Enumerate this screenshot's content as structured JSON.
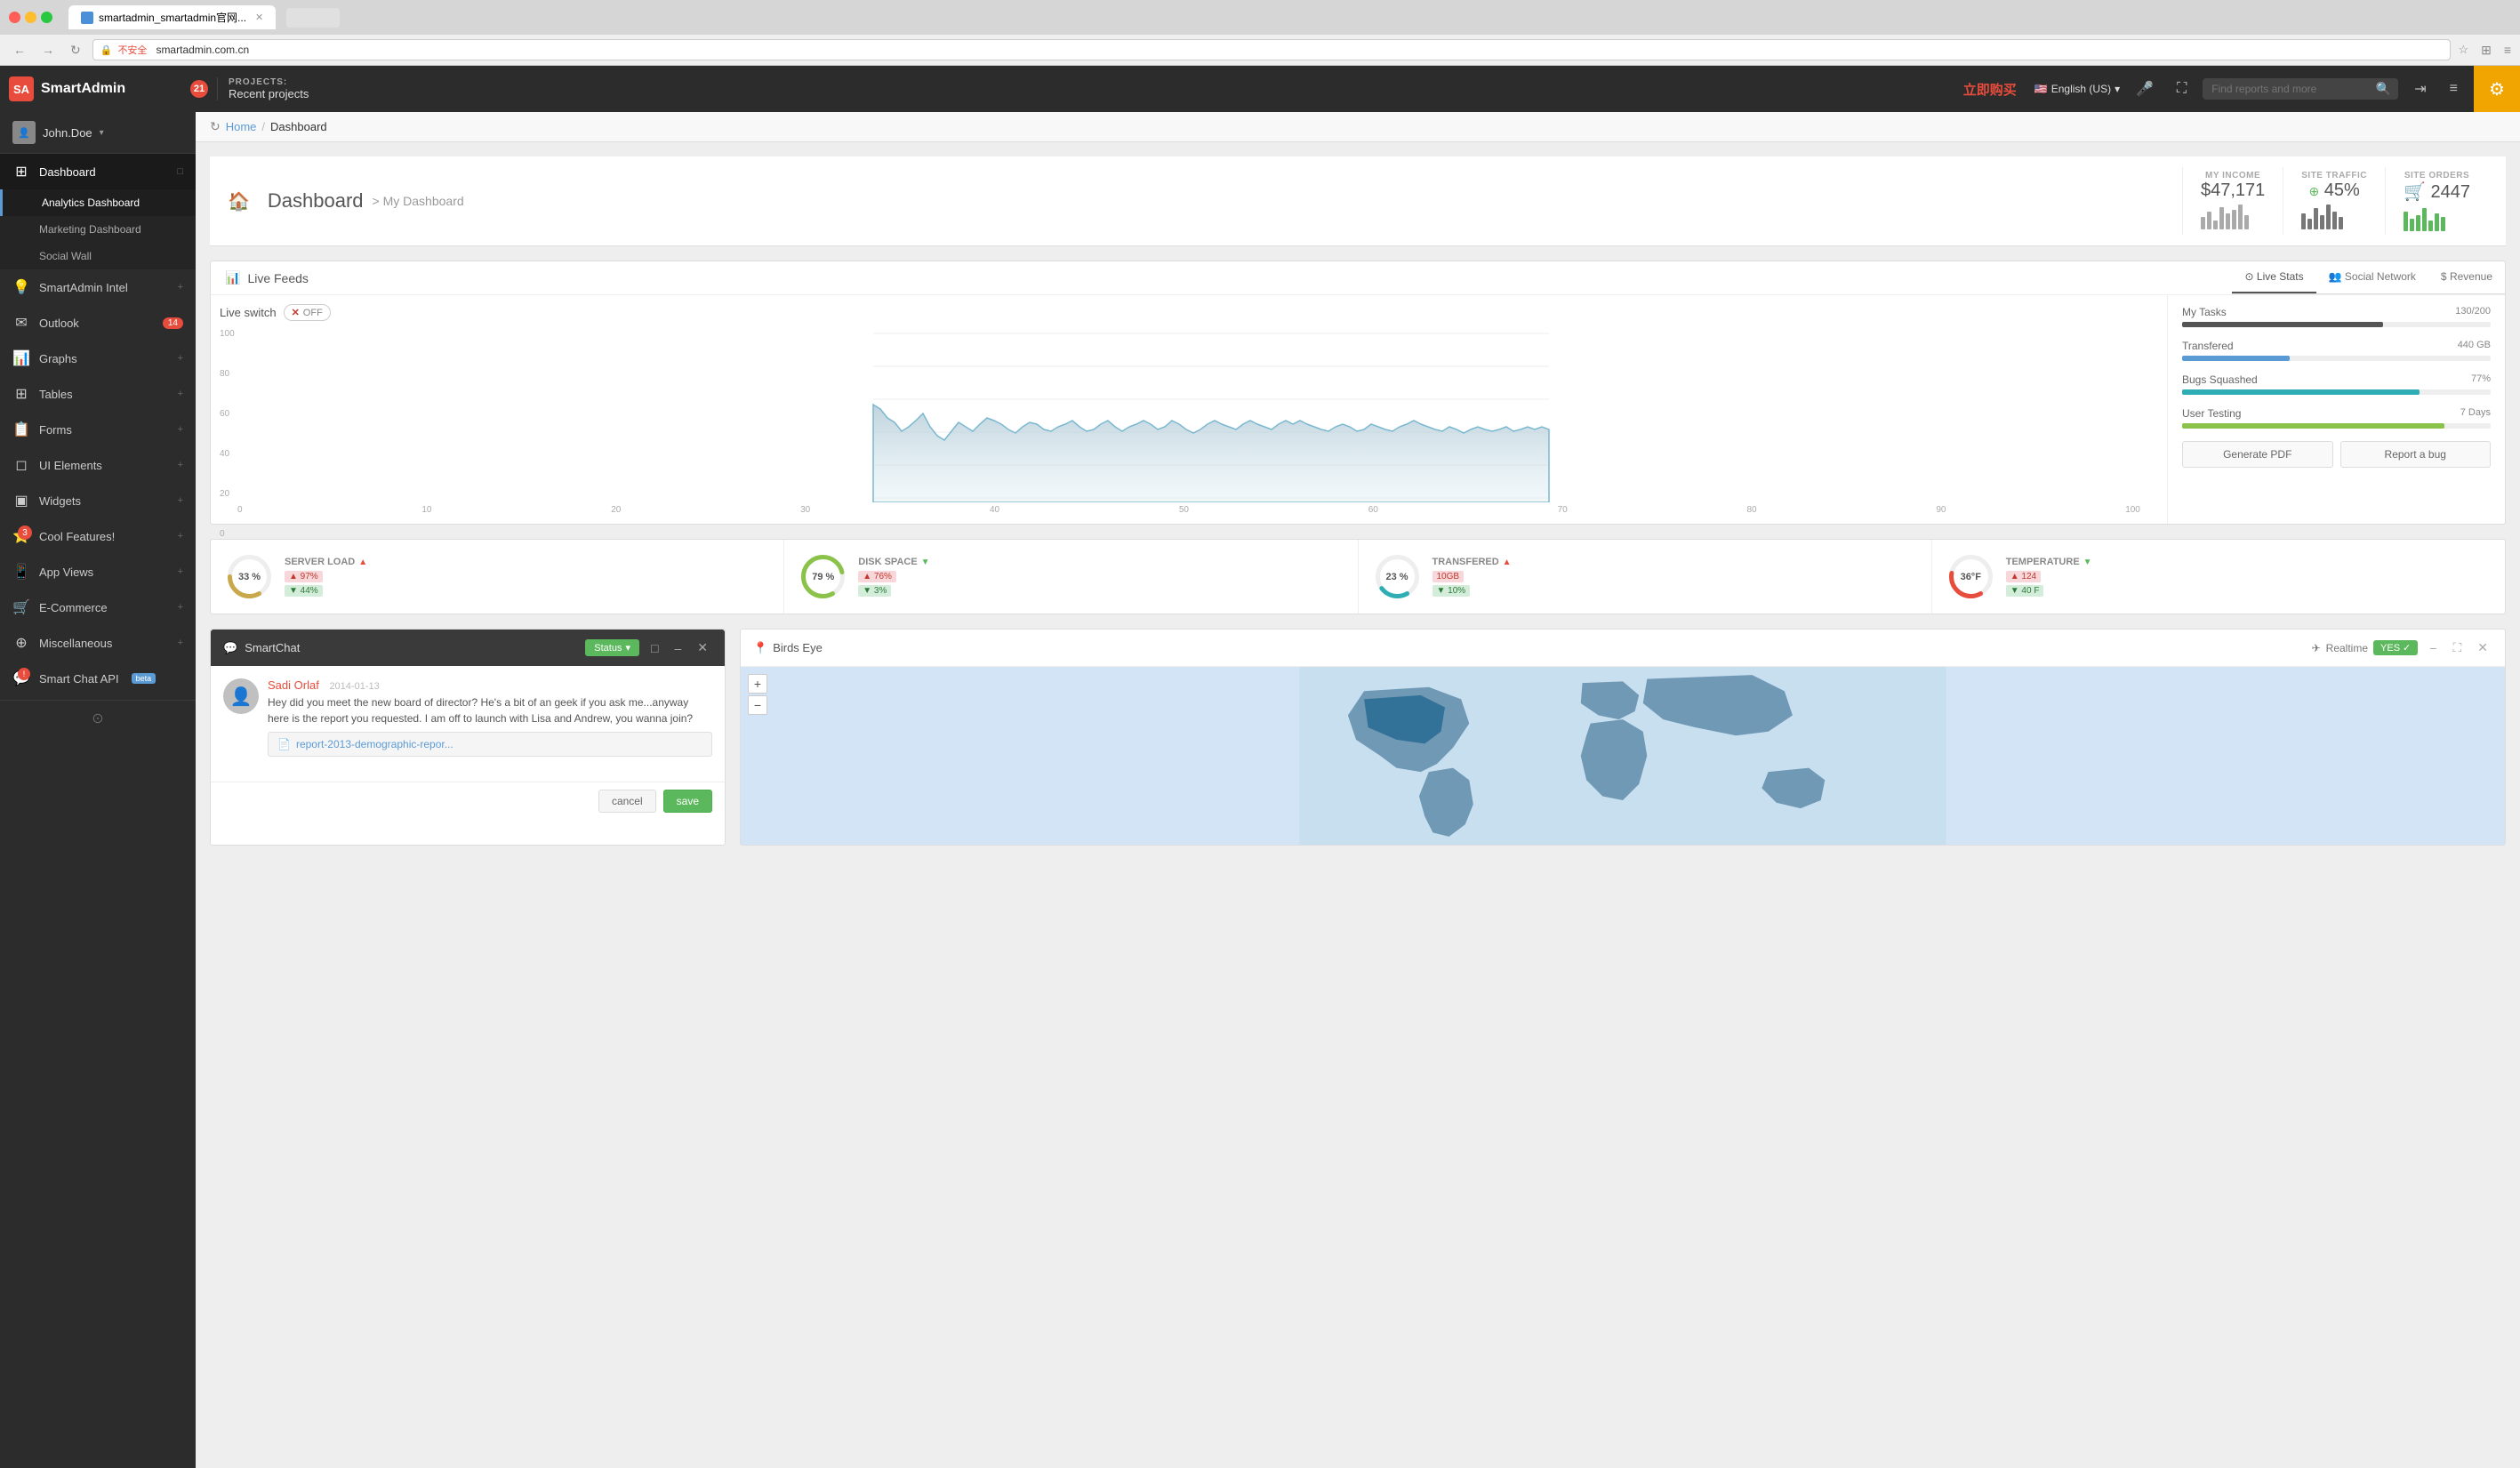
{
  "browser": {
    "title": "smartadmin_smartadmin官网...",
    "url": "smartadmin.com.cn",
    "protocol": "不安全"
  },
  "header": {
    "logo_text": "SmartAdmin",
    "badge_count": "21",
    "projects_label": "PROJECTS:",
    "recent_projects": "Recent projects",
    "buy_label": "立即购买",
    "language": "English (US)",
    "search_placeholder": "Find reports and more",
    "gear_icon": "⚙"
  },
  "breadcrumb": {
    "home": "Home",
    "separator": "/",
    "current": "Dashboard"
  },
  "dashboard": {
    "icon": "🏠",
    "title": "Dashboard",
    "subtitle": "> My Dashboard",
    "my_income_label": "MY INCOME",
    "my_income_value": "$47,171",
    "site_traffic_label": "SITE TRAFFIC",
    "site_traffic_value": "45%",
    "site_orders_label": "SITE ORDERS",
    "site_orders_icon": "🛒",
    "site_orders_value": "2447"
  },
  "live_feeds": {
    "panel_title": "Live Feeds",
    "live_switch_label": "Live switch",
    "switch_state": "OFF",
    "tabs": [
      {
        "id": "live-stats",
        "label": "Live Stats",
        "icon": "⊙",
        "active": true
      },
      {
        "id": "social-network",
        "label": "Social Network",
        "icon": "👥",
        "active": false
      },
      {
        "id": "revenue",
        "label": "Revenue",
        "icon": "$",
        "active": false
      }
    ],
    "chart_y_labels": [
      "100",
      "80",
      "60",
      "40",
      "20",
      "0"
    ],
    "chart_x_labels": [
      "0",
      "10",
      "20",
      "30",
      "40",
      "50",
      "60",
      "70",
      "80",
      "90",
      "100"
    ],
    "stats": [
      {
        "label": "My Tasks",
        "value": "130/200",
        "percent": 65,
        "bar_class": "pb-dark"
      },
      {
        "label": "Transfered",
        "value": "440 GB",
        "percent": 35,
        "bar_class": "pb-blue"
      },
      {
        "label": "Bugs Squashed",
        "value": "77%",
        "percent": 77,
        "bar_class": "pb-teal"
      },
      {
        "label": "User Testing",
        "value": "7 Days",
        "percent": 85,
        "bar_class": "pb-green"
      }
    ],
    "generate_pdf": "Generate PDF",
    "report_bug": "Report a bug"
  },
  "server_stats": [
    {
      "id": "server-load",
      "percent": 33,
      "label": "SERVER LOAD",
      "direction": "up",
      "tags": [
        {
          "label": "▲ 97%",
          "type": "tag-red"
        },
        {
          "label": "▼ 44%",
          "type": "tag-green"
        }
      ],
      "color": "#c8a84b",
      "gauge_color": "#c8a84b"
    },
    {
      "id": "disk-space",
      "percent": 79,
      "label": "DISK SPACE",
      "direction": "down",
      "tags": [
        {
          "label": "▲ 76%",
          "type": "tag-red"
        },
        {
          "label": "▼ 3%",
          "type": "tag-green"
        }
      ],
      "color": "#8bc34a",
      "gauge_color": "#8bc34a"
    },
    {
      "id": "transfered",
      "percent": 23,
      "label": "TRANSFERED",
      "direction": "up",
      "tags": [
        {
          "label": "10GB",
          "type": "tag-red"
        },
        {
          "label": "▼ 10%",
          "type": "tag-green"
        }
      ],
      "color": "#2eadb4",
      "gauge_color": "#2eadb4"
    },
    {
      "id": "temperature",
      "percent": 36,
      "label": "TEMPERATURE",
      "direction": "down",
      "unit": "°F",
      "display": "36°F",
      "tags": [
        {
          "label": "▲ 124",
          "type": "tag-red"
        },
        {
          "label": "▼ 40 F",
          "type": "tag-green"
        }
      ],
      "color": "#e74c3c",
      "gauge_color": "#e74c3c"
    }
  ],
  "chat": {
    "title": "SmartChat",
    "status_label": "Status",
    "message": {
      "sender": "Sadi Orlaf",
      "date": "2014-01-13",
      "text": "Hey did you meet the new board of director? He's a bit of an geek if you ask me...anyway here is the report you requested. I am off to launch with Lisa and Andrew, you wanna join?",
      "attachment": "report-2013-demographic-repor..."
    },
    "cancel_label": "cancel",
    "save_label": "save"
  },
  "map": {
    "title": "Birds Eye",
    "realtime_label": "Realtime",
    "realtime_state": "YES",
    "zoom_in": "+",
    "zoom_out": "−"
  },
  "sidebar": {
    "user_name": "John.Doe",
    "nav_items": [
      {
        "id": "dashboard",
        "label": "Dashboard",
        "icon": "⊞",
        "active": true,
        "has_sub": true
      },
      {
        "id": "analytics",
        "label": "Analytics Dashboard",
        "sub": true,
        "active": true
      },
      {
        "id": "marketing",
        "label": "Marketing Dashboard",
        "sub": true
      },
      {
        "id": "social-wall",
        "label": "Social Wall",
        "sub": true
      },
      {
        "id": "smartadmin-intel",
        "label": "SmartAdmin Intel",
        "icon": "💡",
        "has_expand": true
      },
      {
        "id": "outlook",
        "label": "Outlook",
        "icon": "✉",
        "badge": "14"
      },
      {
        "id": "graphs",
        "label": "Graphs",
        "icon": "📊",
        "has_expand": true
      },
      {
        "id": "tables",
        "label": "Tables",
        "icon": "⊞",
        "has_expand": true
      },
      {
        "id": "forms",
        "label": "Forms",
        "icon": "📋",
        "has_expand": true
      },
      {
        "id": "ui-elements",
        "label": "UI Elements",
        "icon": "◻",
        "has_expand": true
      },
      {
        "id": "widgets",
        "label": "Widgets",
        "icon": "▣",
        "has_expand": true
      },
      {
        "id": "cool-features",
        "label": "Cool Features!",
        "icon": "⭐",
        "badge": "3",
        "has_expand": true
      },
      {
        "id": "app-views",
        "label": "App Views",
        "icon": "📱",
        "has_expand": true
      },
      {
        "id": "ecommerce",
        "label": "E-Commerce",
        "icon": "🛒",
        "has_expand": true
      },
      {
        "id": "miscellaneous",
        "label": "Miscellaneous",
        "icon": "⊕",
        "has_expand": true
      },
      {
        "id": "smart-chat-api",
        "label": "Smart Chat API",
        "icon": "💬",
        "badge_warn": "!",
        "is_beta": true
      }
    ]
  }
}
